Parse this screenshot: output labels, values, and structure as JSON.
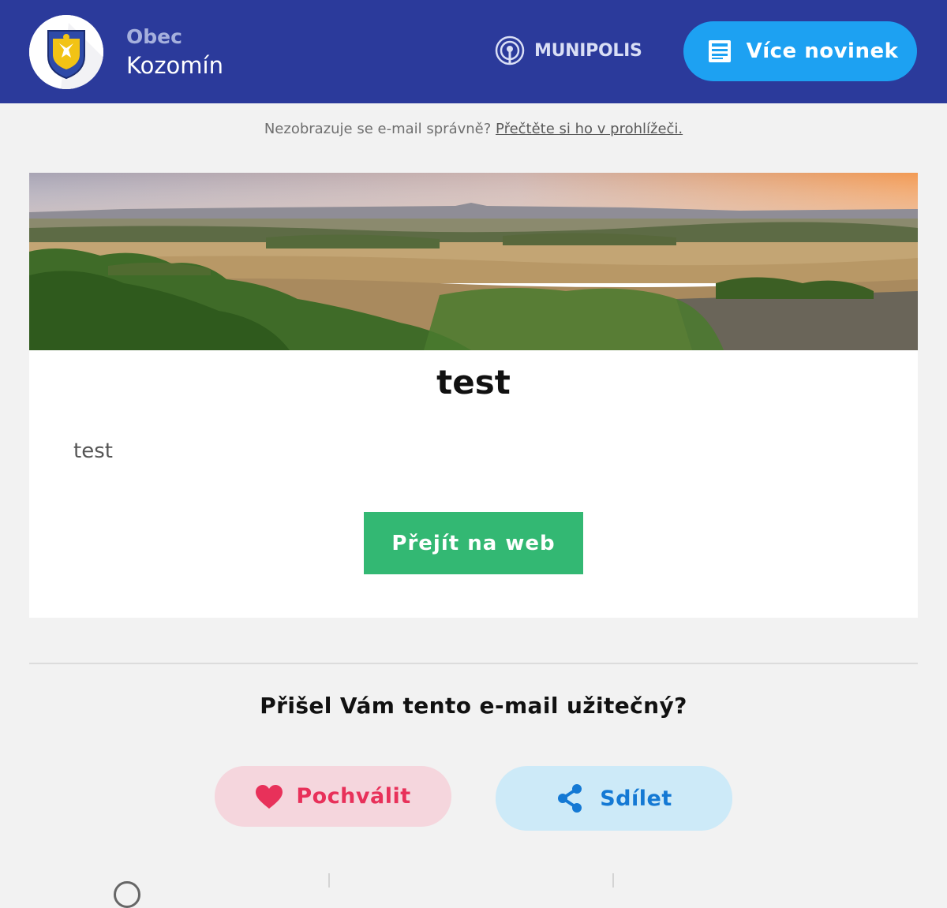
{
  "header": {
    "town_label": "Obec",
    "town_name": "Kozomín",
    "brand": "MUNIPOLIS",
    "more_news_label": "Více novinek",
    "bg_color": "#2b3a9b",
    "button_color": "#1da1f2"
  },
  "preheader": {
    "text": "Nezobrazuje se e-mail správně?",
    "link": "Přečtěte si ho v prohlížeči."
  },
  "article": {
    "title": "test",
    "body": "test",
    "button_label": "Přejít na web",
    "button_color": "#33b873"
  },
  "feedback": {
    "question": "Přišel Vám tento e-mail užitečný?",
    "praise_label": "Pochválit",
    "share_label": "Sdílet",
    "praise_color": "#e8315a",
    "share_color": "#1479d4"
  },
  "icons": {
    "crest": "coat-of-arms-icon",
    "brand": "broadcast-icon",
    "more_news": "newspaper-icon",
    "praise": "heart-icon",
    "share": "share-icon"
  }
}
